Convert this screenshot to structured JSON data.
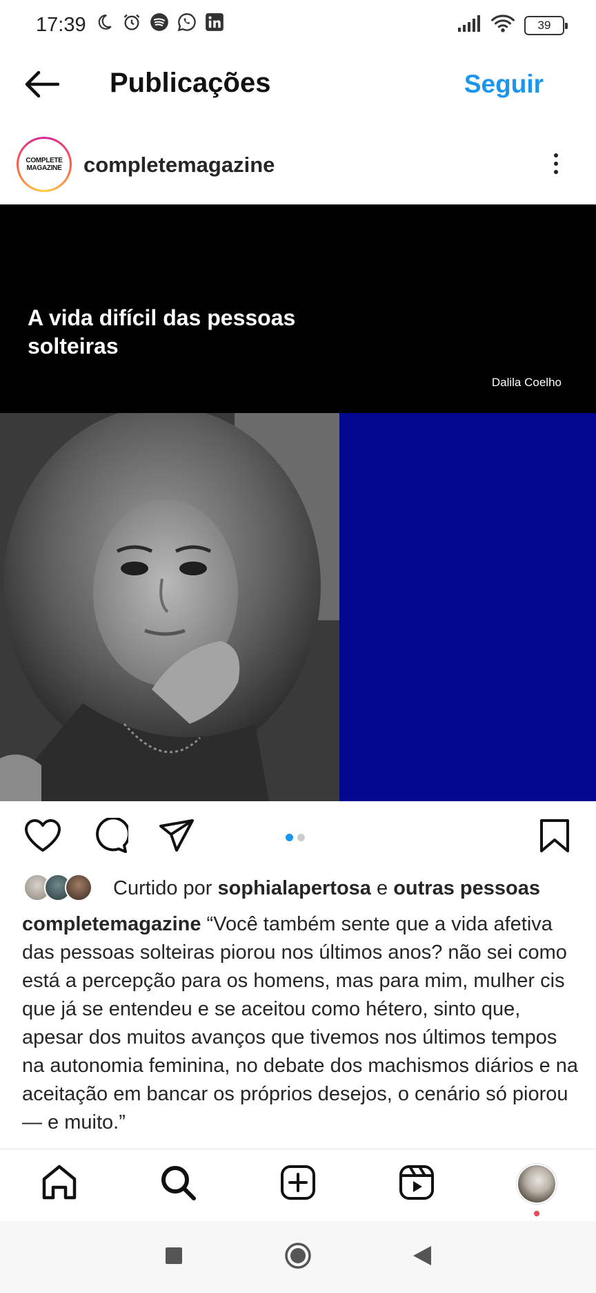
{
  "status_bar": {
    "time": "17:39",
    "left_icons": [
      "moon-icon",
      "alarm-icon",
      "spotify-icon",
      "whatsapp-icon",
      "linkedin-icon"
    ],
    "right_icons": [
      "signal-icon",
      "wifi-icon",
      "battery-icon"
    ],
    "battery": "39"
  },
  "header": {
    "back_icon": "arrow-left-icon",
    "title": "Publicações",
    "follow_label": "Seguir"
  },
  "post": {
    "avatar_text_line1": "COMPLETE",
    "avatar_text_line2": "MAGAZINE",
    "username": "completemagazine",
    "more_icon": "more-vertical-icon",
    "media": {
      "headline": "A vida difícil das pessoas solteiras",
      "author": "Dalila Coelho",
      "colors": {
        "top_band": "#000000",
        "right_panel": "#020990"
      }
    },
    "carousel": {
      "count": 2,
      "active_index": 0
    },
    "likes": {
      "prefix": "Curtido por",
      "user": "sophialapertosa",
      "connector": "e",
      "others": "outras pessoas"
    },
    "caption": {
      "username": "completemagazine",
      "text": "“Você também sente que a vida afetiva das pessoas solteiras piorou nos últimos anos? não sei como está a percepção para os homens, mas para mim, mulher cis que já se entendeu e se aceitou como hétero, sinto que, apesar dos muitos avanços que tivemos nos últimos tempos na autonomia feminina, no debate dos machismos diários e na aceitação em bancar os próprios desejos, o cenário só piorou — e muito.”"
    }
  },
  "actions": [
    "heart-icon",
    "comment-icon",
    "share-icon",
    "bookmark-icon"
  ],
  "bottom_nav": [
    "home-icon",
    "search-icon",
    "add-post-icon",
    "reels-icon",
    "profile-avatar"
  ],
  "system_nav": [
    "recent-apps-icon",
    "home-circle-icon",
    "back-triangle-icon"
  ],
  "colors": {
    "accent": "#1c95ec",
    "text": "#262626",
    "notification": "#ed4956"
  }
}
